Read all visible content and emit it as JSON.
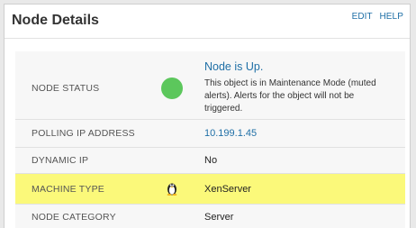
{
  "panel": {
    "title": "Node Details",
    "actions": {
      "edit_label": "EDIT",
      "help_label": "HELP"
    }
  },
  "details": {
    "node_status": {
      "label": "NODE STATUS",
      "status_title": "Node is Up.",
      "status_note": "This object is in Maintenance Mode (muted alerts). Alerts for the object will not be triggered.",
      "indicator_color": "#5cc75c"
    },
    "polling_ip": {
      "label": "POLLING IP ADDRESS",
      "value": "10.199.1.45"
    },
    "dynamic_ip": {
      "label": "DYNAMIC IP",
      "value": "No"
    },
    "machine_type": {
      "label": "MACHINE TYPE",
      "icon": "linux-tux-icon",
      "value": "XenServer",
      "highlight_color": "#fbf97a"
    },
    "node_category": {
      "label": "NODE CATEGORY",
      "value": "Server"
    }
  }
}
